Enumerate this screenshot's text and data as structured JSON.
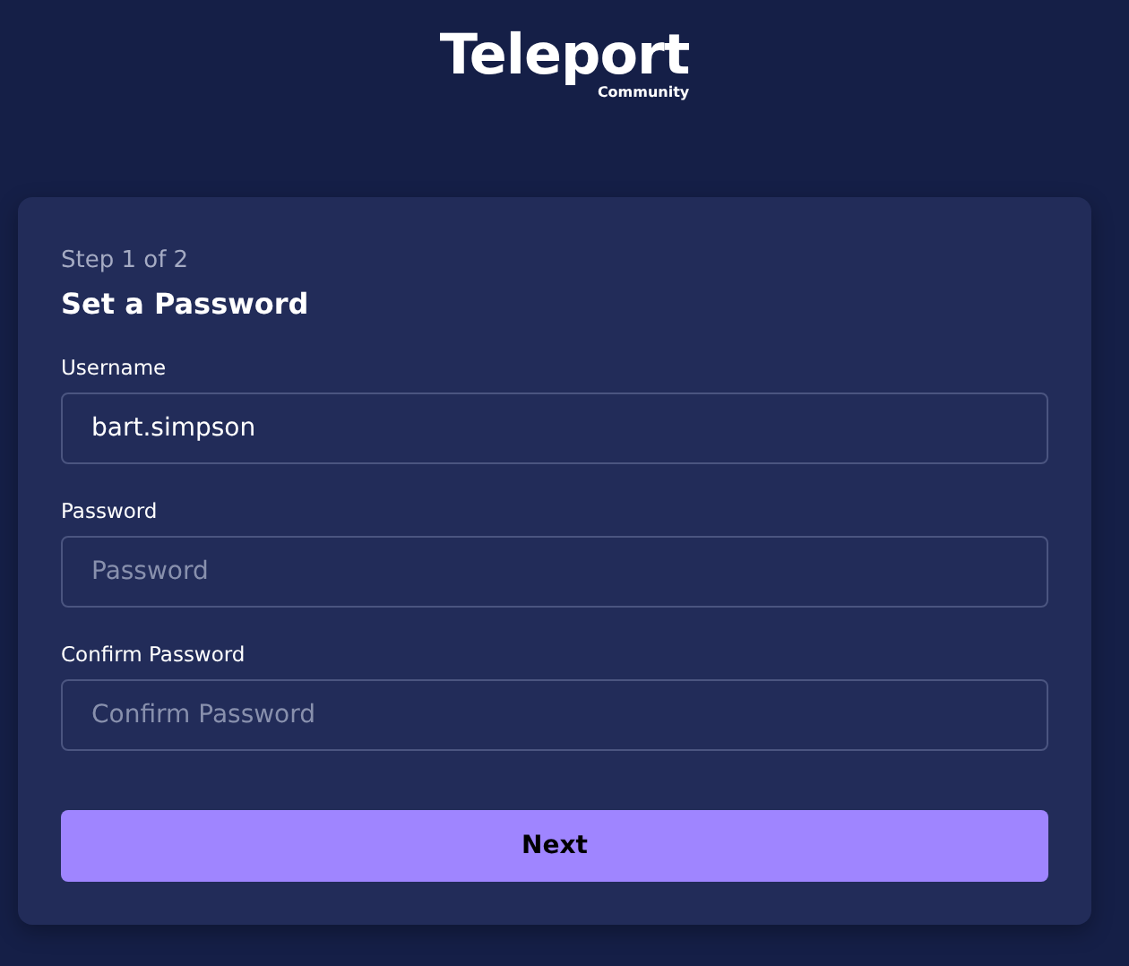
{
  "logo": {
    "name": "Teleport",
    "edition": "Community"
  },
  "form": {
    "step": "Step 1 of 2",
    "title": "Set a Password",
    "fields": [
      {
        "label": "Username",
        "value": "bart.simpson"
      },
      {
        "label": "Password",
        "placeholder": "Password"
      },
      {
        "label": "Confirm Password",
        "placeholder": "Confirm Password"
      }
    ],
    "submit": "Next"
  }
}
